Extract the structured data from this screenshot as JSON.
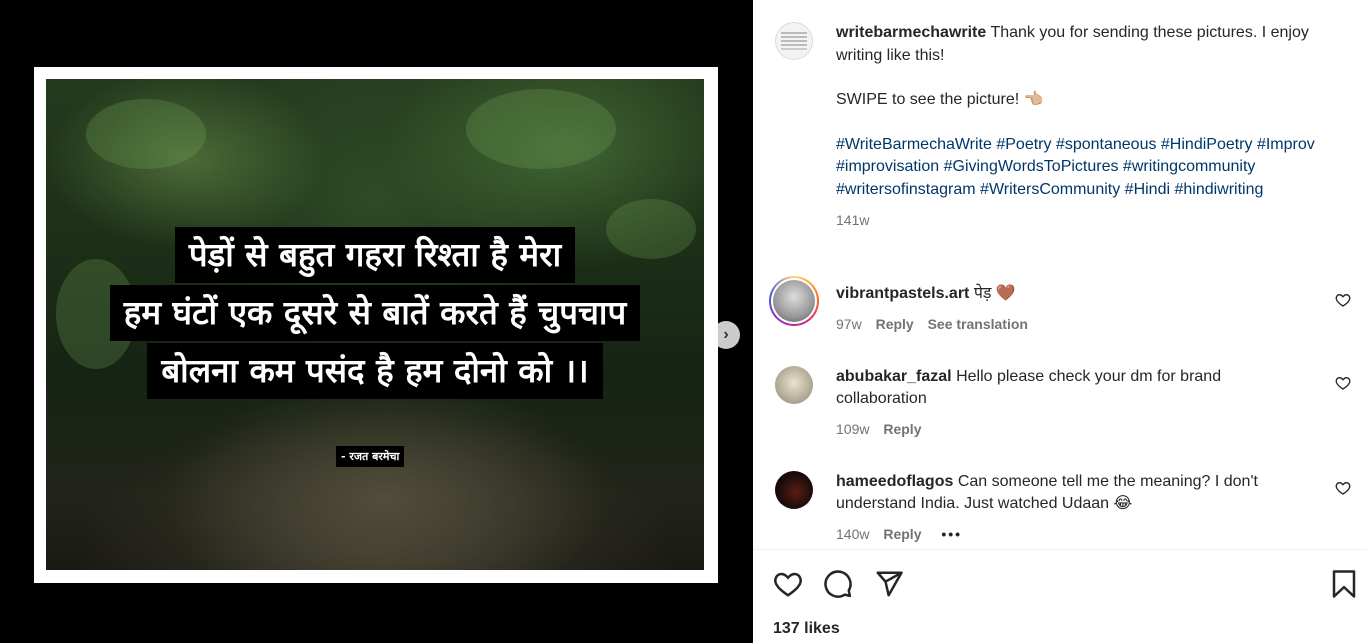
{
  "post": {
    "poem_lines": [
      "पेड़ों से बहुत गहरा रिश्ता है मेरा",
      "हम घंटों एक दूसरे से बातें करते हैं चुपचाप",
      "बोलना कम पसंद है हम दोनो को ।।"
    ],
    "poem_author": "- रजत बरमेचा"
  },
  "caption": {
    "username": "writebarmechawrite",
    "text_1": "Thank you for sending these pictures. I enjoy writing like this!",
    "text_2": "SWIPE to see the picture! 👈🏼",
    "hashtags": "#WriteBarmechaWrite #Poetry #spontaneous #HindiPoetry #Improv #improvisation #GivingWordsToPictures #writingcommunity #writersofinstagram #WritersCommunity #Hindi #hindiwriting",
    "age": "141w"
  },
  "comments": [
    {
      "username": "vibrantpastels.art",
      "text": "पेड़ 🤎",
      "age": "97w",
      "reply": "Reply",
      "translate": "See translation"
    },
    {
      "username": "abubakar_fazal",
      "text": "Hello please check your dm for brand collaboration",
      "age": "109w",
      "reply": "Reply"
    },
    {
      "username": "hameedoflagos",
      "text": "Can someone tell me the meaning? I don't understand India. Just watched Udaan 😂",
      "age": "140w",
      "reply": "Reply",
      "more": "•••"
    }
  ],
  "likes": "137 likes",
  "icons": [
    "heart-icon",
    "comment-icon",
    "share-icon",
    "bookmark-icon",
    "chevron-right-icon"
  ]
}
